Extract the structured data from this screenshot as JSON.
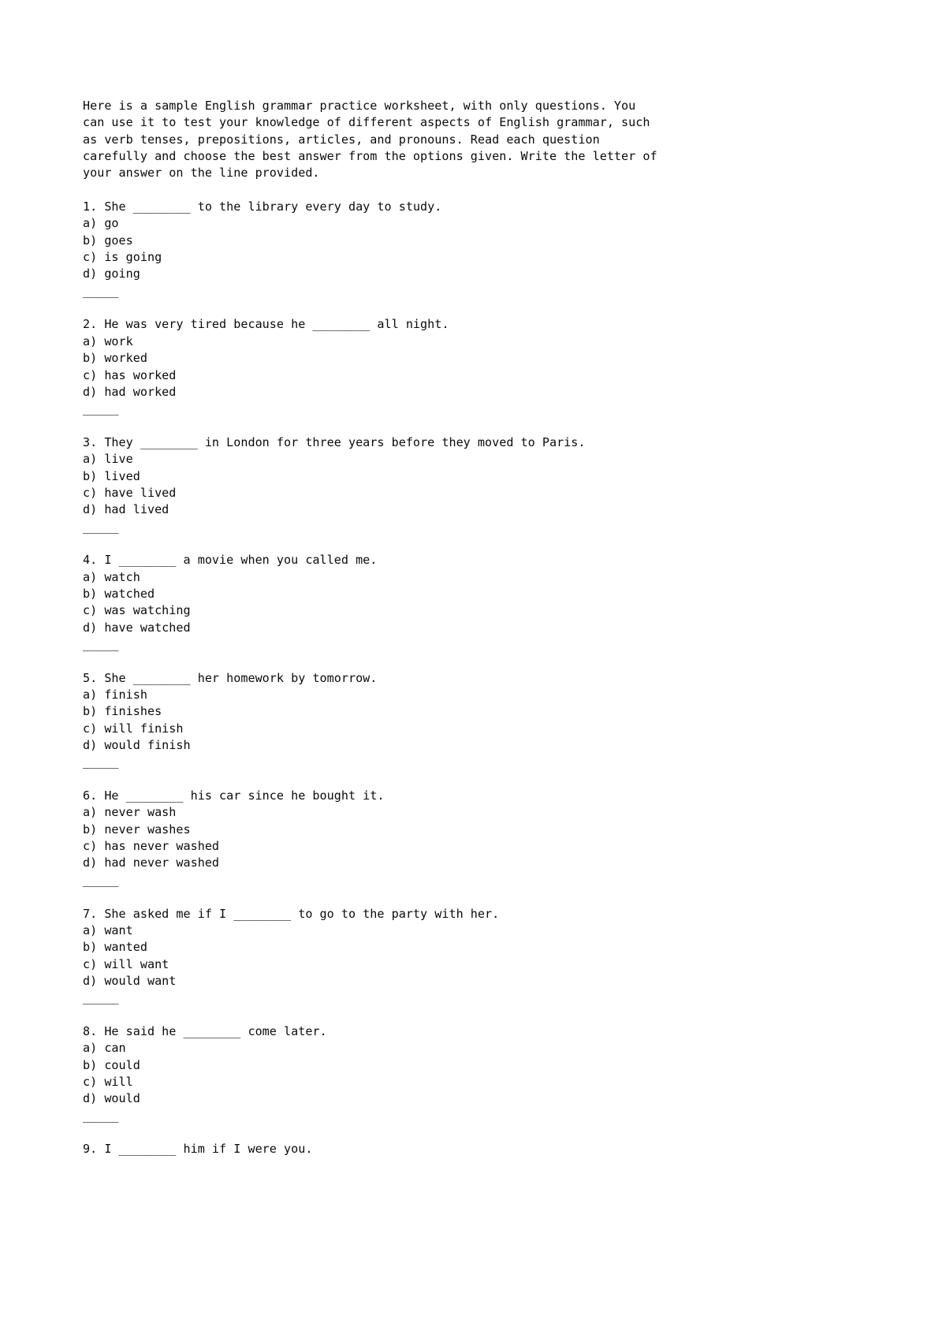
{
  "document": {
    "kind": "plain-text-worksheet-page",
    "background_color": "#ffffff",
    "text_color": "#0a0a0a",
    "intro": {
      "lines": [
        "Here is a sample English grammar practice worksheet, with only questions. You",
        "can use it to test your knowledge of different aspects of English grammar, such",
        "as verb tenses, prepositions, articles, and pronouns. Read each question",
        "carefully and choose the best answer from the options given. Write the letter of",
        "your answer on the line provided."
      ]
    },
    "separator": "_____",
    "questions": [
      {
        "number": "1.",
        "stem": "1. She ________ to the library every day to study.",
        "options": [
          "a) go",
          "b) goes",
          "c) is going",
          "d) going"
        ]
      },
      {
        "number": "2.",
        "stem": "2. He was very tired because he ________ all night.",
        "options": [
          "a) work",
          "b) worked",
          "c) has worked",
          "d) had worked"
        ]
      },
      {
        "number": "3.",
        "stem": "3. They ________ in London for three years before they moved to Paris.",
        "options": [
          "a) live",
          "b) lived",
          "c) have lived",
          "d) had lived"
        ]
      },
      {
        "number": "4.",
        "stem": "4. I ________ a movie when you called me.",
        "options": [
          "a) watch",
          "b) watched",
          "c) was watching",
          "d) have watched"
        ]
      },
      {
        "number": "5.",
        "stem": "5. She ________ her homework by tomorrow.",
        "options": [
          "a) finish",
          "b) finishes",
          "c) will finish",
          "d) would finish"
        ]
      },
      {
        "number": "6.",
        "stem": "6. He ________ his car since he bought it.",
        "options": [
          "a) never wash",
          "b) never washes",
          "c) has never washed",
          "d) had never washed"
        ]
      },
      {
        "number": "7.",
        "stem": "7. She asked me if I ________ to go to the party with her.",
        "options": [
          "a) want",
          "b) wanted",
          "c) will want",
          "d) would want"
        ]
      },
      {
        "number": "8.",
        "stem": "8. He said he ________ come later.",
        "options": [
          "a) can",
          "b) could",
          "c) will",
          "d) would"
        ]
      },
      {
        "number": "9.",
        "stem": "9. I ________ him if I were you.",
        "options": []
      }
    ]
  }
}
